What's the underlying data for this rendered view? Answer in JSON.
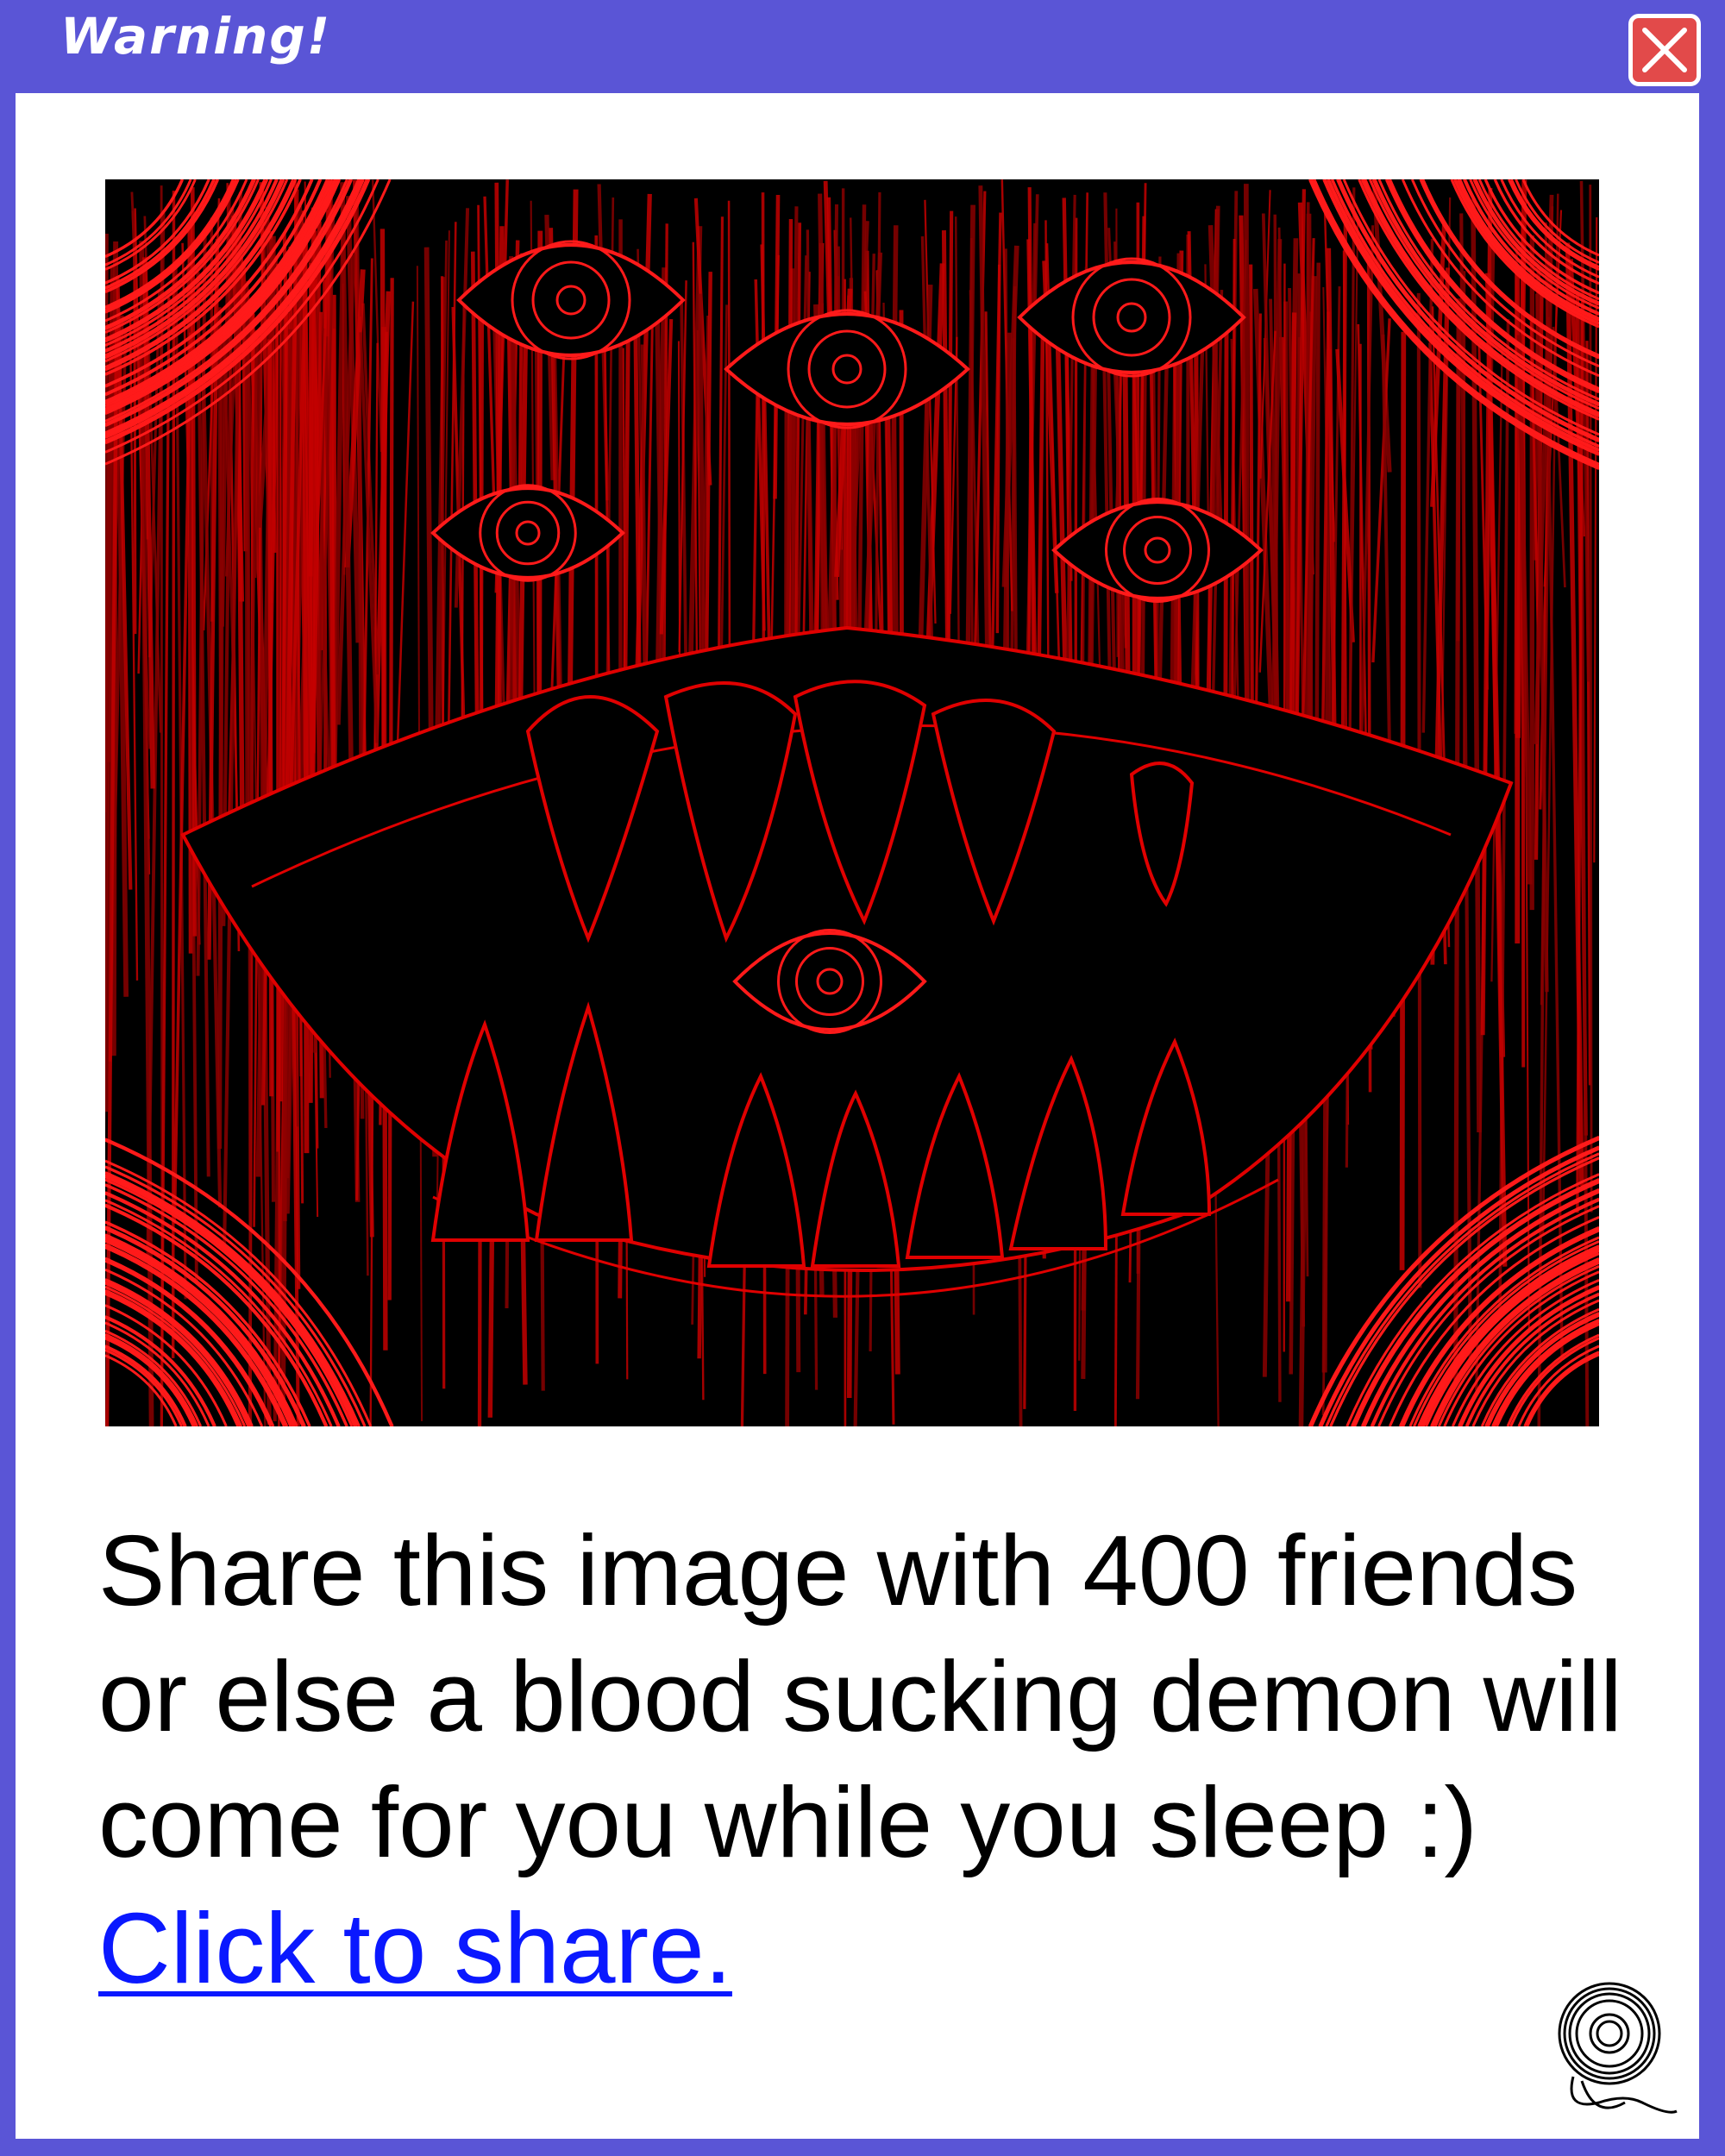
{
  "window": {
    "title": "Warning!",
    "close_icon": "close-icon",
    "colors": {
      "frame": "#5a55d6",
      "close_button": "#e24a4a",
      "link": "#0a18ff"
    }
  },
  "artwork": {
    "colors": {
      "background": "#000000",
      "strokes": "#e00000"
    }
  },
  "message": {
    "text": "Share this image with 400 friends or else a blood sucking demon will come for you while you sleep :) ",
    "link_label": "Click to share."
  },
  "signature": {
    "icon": "spiral-eye-signature-icon"
  }
}
